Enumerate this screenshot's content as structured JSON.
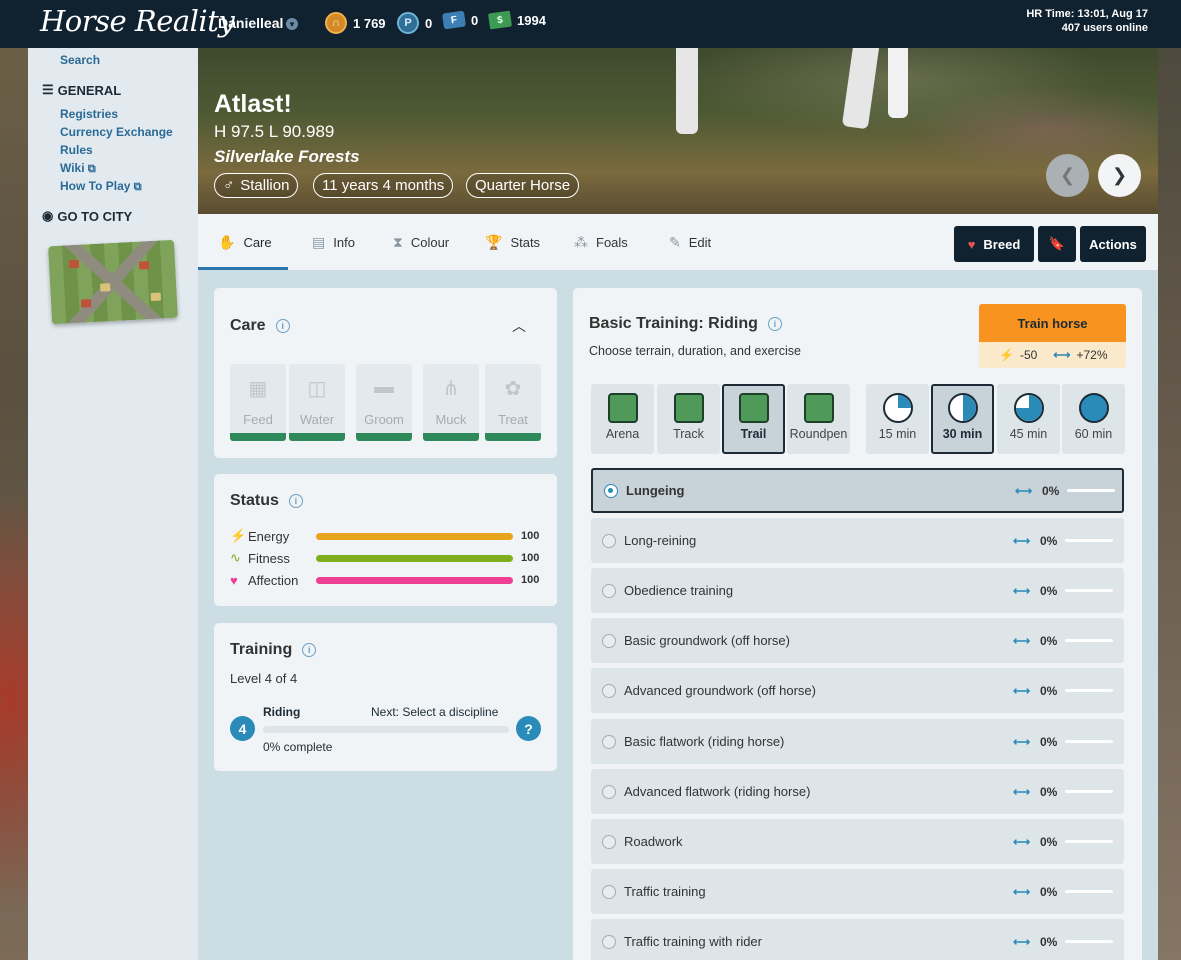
{
  "header": {
    "logo": "Horse Reality",
    "username": "Danielleal",
    "currencies": [
      {
        "icon": "horseshoe-coin-icon",
        "value": "1 769"
      },
      {
        "icon": "pass-icon",
        "value": "0"
      },
      {
        "icon": "ticket-icon",
        "value": "0"
      },
      {
        "icon": "bill-icon",
        "value": "1994"
      }
    ],
    "hr_time": "HR Time: 13:01, Aug 17",
    "users_online": "407 users online"
  },
  "sidebar": {
    "search": "Search",
    "general_heading": "GENERAL",
    "links": [
      "Registries",
      "Currency Exchange",
      "Rules",
      "Wiki",
      "How To Play"
    ],
    "city_heading": "GO TO CITY"
  },
  "horse": {
    "name": "Atlast!",
    "stats": "H 97.5 L 90.989",
    "location": "Silverlake Forests",
    "gender": "Stallion",
    "age": "11 years 4 months",
    "breed": "Quarter Horse"
  },
  "tabs": [
    "Care",
    "Info",
    "Colour",
    "Stats",
    "Foals",
    "Edit"
  ],
  "actions": {
    "breed": "Breed",
    "actions": "Actions"
  },
  "care": {
    "title": "Care",
    "items": [
      "Feed",
      "Water",
      "Groom",
      "Muck",
      "Treat"
    ]
  },
  "status": {
    "title": "Status",
    "rows": [
      {
        "name": "Energy",
        "value": 100,
        "color": "#e8a41c"
      },
      {
        "name": "Fitness",
        "value": 100,
        "color": "#7fae1e"
      },
      {
        "name": "Affection",
        "value": 100,
        "color": "#ee3f95"
      }
    ]
  },
  "training": {
    "title": "Training",
    "level": "Level 4 of 4",
    "badge": "4",
    "discipline": "Riding",
    "next": "Next: Select a discipline",
    "progress": "0% complete",
    "progress_fraction": 0
  },
  "basic_training": {
    "title": "Basic Training: Riding",
    "subtitle": "Choose terrain, duration, and exercise",
    "train_button": "Train horse",
    "energy_cost": "-50",
    "gain": "+72%",
    "terrains": [
      "Arena",
      "Track",
      "Trail",
      "Roundpen"
    ],
    "selected_terrain": "Trail",
    "durations": [
      "15 min",
      "30 min",
      "45 min",
      "60 min"
    ],
    "selected_duration": "30 min",
    "exercises": [
      {
        "name": "Lungeing",
        "gain": "0%"
      },
      {
        "name": "Long-reining",
        "gain": "0%"
      },
      {
        "name": "Obedience training",
        "gain": "0%"
      },
      {
        "name": "Basic groundwork (off horse)",
        "gain": "0%"
      },
      {
        "name": "Advanced groundwork (off horse)",
        "gain": "0%"
      },
      {
        "name": "Basic flatwork (riding horse)",
        "gain": "0%"
      },
      {
        "name": "Advanced flatwork (riding horse)",
        "gain": "0%"
      },
      {
        "name": "Roadwork",
        "gain": "0%"
      },
      {
        "name": "Traffic training",
        "gain": "0%"
      },
      {
        "name": "Traffic training with rider",
        "gain": "0%"
      }
    ]
  }
}
